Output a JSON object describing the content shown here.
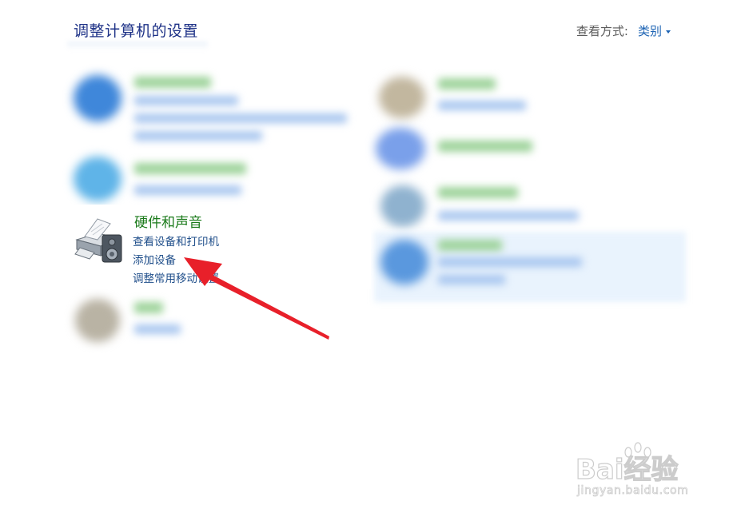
{
  "header": {
    "title": "调整计算机的设置",
    "view_by_label": "查看方式:",
    "view_by_value": "类别"
  },
  "hardware_sound": {
    "title": "硬件和声音",
    "links": [
      "查看设备和打印机",
      "添加设备",
      "调整常用移动设置"
    ]
  },
  "annotation": {
    "type": "red-arrow",
    "points_to": "添加设备",
    "color": "#e8202a"
  },
  "watermark": {
    "brand": "Bai经验",
    "url": "jingyan.baidu.com"
  },
  "colors": {
    "title": "#1e3287",
    "category_title": "#1a7a1a",
    "link": "#1f4e8a",
    "view_by_value": "#1e64b4"
  }
}
